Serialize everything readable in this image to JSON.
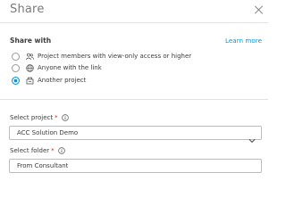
{
  "dialog": {
    "title": "Share",
    "close_icon": "close-icon"
  },
  "share_with": {
    "label": "Share with",
    "learn_more": "Learn more",
    "options": [
      {
        "label": "Project members with view-only access or higher",
        "icon": "people-icon",
        "selected": false
      },
      {
        "label": "Anyone with the link",
        "icon": "globe-icon",
        "selected": false
      },
      {
        "label": "Another project",
        "icon": "project-icon",
        "selected": true
      }
    ]
  },
  "select_project": {
    "label": "Select project",
    "required_marker": "*",
    "info_icon": "info-icon",
    "value": "ACC Solution Demo",
    "dropdown_icon": "chevron-down-icon"
  },
  "select_folder": {
    "label": "Select folder",
    "required_marker": "*",
    "info_icon": "info-icon",
    "value": "From Consultant"
  },
  "colors": {
    "accent": "#0696d7",
    "required": "#c1272d",
    "border": "#bdbdbd",
    "text": "#3c3c3c"
  }
}
